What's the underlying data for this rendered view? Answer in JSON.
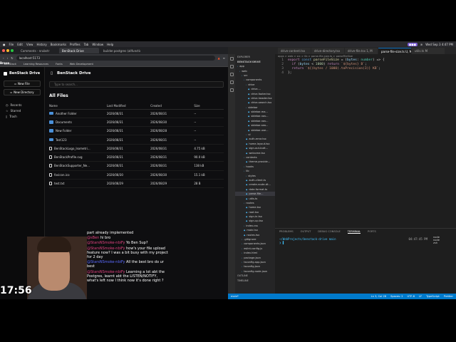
{
  "menubar": {
    "app": "Brave",
    "items": [
      "File",
      "Edit",
      "View",
      "History",
      "Bookmarks",
      "Profiles",
      "Tab",
      "Window",
      "Help"
    ],
    "datetime": "Wed Sep 3  4:47 PM"
  },
  "browser": {
    "tabs": [
      "Comments - nrubstr",
      "BenStack Drive",
      "builder.postgres (allfunctions)"
    ],
    "url": "localhost:5173",
    "bookmarks": [
      "BenStack",
      "Learning Resources",
      "Fonts",
      "Web Development"
    ]
  },
  "drive": {
    "brand": "BenStack Drive",
    "header_title": "BenStack Drive",
    "new_file": "New File",
    "new_directory": "New Directory",
    "nav": [
      "Recents",
      "Starred",
      "Trash"
    ],
    "search_placeholder": "Type to search...",
    "section_title": "All Files",
    "columns": [
      "Name",
      "Last Modified",
      "Created",
      "Size"
    ],
    "rows": [
      {
        "type": "folder",
        "name": "Another Folder",
        "modified": "2026/08/31",
        "created": "2026/08/31",
        "size": "--"
      },
      {
        "type": "folder",
        "name": "Documents",
        "modified": "2026/08/31",
        "created": "2026/08/30",
        "size": "--"
      },
      {
        "type": "folder",
        "name": "New Folder",
        "modified": "2026/08/31",
        "created": "2026/08/28",
        "size": "--"
      },
      {
        "type": "folder",
        "name": "Test123",
        "modified": "2026/08/31",
        "created": "2026/08/31",
        "size": "--"
      },
      {
        "type": "file",
        "name": "BenStackLogo_Isometri...",
        "modified": "2026/08/31",
        "created": "2026/08/31",
        "size": "4.75 kB"
      },
      {
        "type": "file",
        "name": "BenStackProfile.svg",
        "modified": "2026/08/31",
        "created": "2026/08/31",
        "size": "90.0 kB"
      },
      {
        "type": "file",
        "name": "BenStackSupporter_Ne...",
        "modified": "2026/08/31",
        "created": "2026/08/31",
        "size": "138 kB"
      },
      {
        "type": "file",
        "name": "favicon.ico",
        "modified": "2026/08/30",
        "created": "2026/08/30",
        "size": "15.1 kB"
      },
      {
        "type": "file",
        "name": "test.txt",
        "modified": "2026/08/29",
        "created": "2026/08/29",
        "size": "28 B"
      }
    ]
  },
  "stream": {
    "clock": "17:56",
    "chat": [
      {
        "user": "",
        "text": "part already implemented"
      },
      {
        "user": "@sBen",
        "text": " hi bro"
      },
      {
        "user": "@StarsNSmoke-nbiFy",
        "text": " Yo Ben Sup?"
      },
      {
        "user": "@StarsNSmoke-nbiFy",
        "text": " how's your file upload feature now? I was a bit busy with my project for 2 day"
      },
      {
        "user": "@StarsNSmoke-nbiFy",
        "text": " All the best bro do ur best"
      },
      {
        "user": "@StarsNSmoke-nbiFy",
        "text": " Learning a lot abt the Postgres, learnt abt the LISTEN/NOTIFY, what's left now I think now it's done right ?"
      }
    ]
  },
  "vscode": {
    "tabs": [
      "drive-content.tsx",
      "drive-directory.tsx",
      "drive-file.tsx 1, M",
      "parse-file-size.ts U, M",
      "utils.ts M"
    ],
    "explorer_title": "EXPLORER",
    "project": "BENSTACK-DRIVE",
    "tree": [
      {
        "name": "app",
        "depth": 0
      },
      {
        "name": "web",
        "depth": 1
      },
      {
        "name": "src",
        "depth": 2
      },
      {
        "name": "components",
        "depth": 3
      },
      {
        "name": "drive",
        "depth": 4
      },
      {
        "name": "drive-...",
        "depth": 5,
        "tsx": true
      },
      {
        "name": "drive-footer.tsx",
        "depth": 5,
        "tsx": true
      },
      {
        "name": "drive-header.tsx",
        "depth": 5,
        "tsx": true
      },
      {
        "name": "drive-search.tsx",
        "depth": 5,
        "tsx": true
      },
      {
        "name": "sidebar",
        "depth": 4
      },
      {
        "name": "sidebar-ma...",
        "depth": 5,
        "tsx": true
      },
      {
        "name": "sidebar-nav...",
        "depth": 5,
        "tsx": true
      },
      {
        "name": "sidebar-nav...",
        "depth": 5,
        "tsx": true
      },
      {
        "name": "sidebar-sea...",
        "depth": 5,
        "tsx": true
      },
      {
        "name": "sidebar-use...",
        "depth": 5,
        "tsx": true
      },
      {
        "name": "ui",
        "depth": 4
      },
      {
        "name": "auth-error.tsx",
        "depth": 4,
        "tsx": true
      },
      {
        "name": "home-layout.tsx",
        "depth": 4,
        "tsx": true
      },
      {
        "name": "sign-out-butt...",
        "depth": 4,
        "tsx": true
      },
      {
        "name": "welcome.tsx",
        "depth": 4,
        "tsx": true
      },
      {
        "name": "contexts",
        "depth": 3
      },
      {
        "name": "theme-provide...",
        "depth": 4,
        "tsx": true
      },
      {
        "name": "hooks",
        "depth": 3
      },
      {
        "name": "lib",
        "depth": 3
      },
      {
        "name": "styles",
        "depth": 4
      },
      {
        "name": "auth-client.ts",
        "depth": 4,
        "tsx": true
      },
      {
        "name": "create-route-dt...",
        "depth": 4,
        "tsx": true
      },
      {
        "name": "date-format.ts",
        "depth": 4,
        "tsx": true
      },
      {
        "name": "parse-file...",
        "depth": 4,
        "tsx": true,
        "selected": true
      },
      {
        "name": "utils.ts",
        "depth": 4,
        "tsx": true
      },
      {
        "name": "routes",
        "depth": 3
      },
      {
        "name": "home.tsx",
        "depth": 4,
        "tsx": true
      },
      {
        "name": "root.tsx",
        "depth": 4,
        "tsx": true
      },
      {
        "name": "sign-in.tsx",
        "depth": 4,
        "tsx": true
      },
      {
        "name": "sign-up.tsx",
        "depth": 4,
        "tsx": true
      },
      {
        "name": "index.css",
        "depth": 3
      },
      {
        "name": "main.tsx",
        "depth": 3,
        "tsx": true
      },
      {
        "name": "routes.tsx",
        "depth": 3,
        "tsx": true
      },
      {
        "name": ".gitignore",
        "depth": 2
      },
      {
        "name": "components.json",
        "depth": 2
      },
      {
        "name": "eslint.config.js",
        "depth": 2
      },
      {
        "name": "index.html",
        "depth": 2
      },
      {
        "name": "package.json",
        "depth": 2
      },
      {
        "name": "tsconfig.app.json",
        "depth": 2
      },
      {
        "name": "tsconfig.json",
        "depth": 2
      },
      {
        "name": "tsconfig.node.json",
        "depth": 2
      }
    ],
    "outline": "OUTLINE",
    "timeline": "TIMELINE",
    "breadcrumb": "apps > web > src > lib > parse-file-size.ts > parseFileSize",
    "code": [
      {
        "n": "1",
        "parts": [
          [
            "kw",
            "export "
          ],
          [
            "kw2",
            "const "
          ],
          [
            "fn",
            "parseFileSize"
          ],
          [
            "pl",
            " = ("
          ],
          [
            "var",
            "bytes"
          ],
          [
            "pl",
            ": "
          ],
          [
            "ty",
            "number"
          ],
          [
            "pl",
            ") => {"
          ]
        ]
      },
      {
        "n": "2",
        "parts": [
          [
            "pl",
            "  "
          ],
          [
            "kw",
            "if "
          ],
          [
            "pl",
            "("
          ],
          [
            "var",
            "bytes"
          ],
          [
            "pl",
            " < "
          ],
          [
            "num",
            "1000"
          ],
          [
            "pl",
            ") "
          ],
          [
            "kw",
            "return "
          ],
          [
            "str",
            "`${bytes} B`"
          ],
          [
            "pl",
            ";"
          ]
        ]
      },
      {
        "n": "3",
        "parts": [
          [
            "pl",
            "  "
          ],
          [
            "kw",
            "return "
          ],
          [
            "str",
            "`${(bytes / 1000).toPrecision(3)} KB`"
          ],
          [
            "pl",
            ";"
          ]
        ]
      },
      {
        "n": "4",
        "parts": [
          [
            "pl",
            "};"
          ]
        ]
      }
    ],
    "panel_tabs": [
      "PROBLEMS",
      "OUTPUT",
      "DEBUG CONSOLE",
      "TERMINAL",
      "PORTS"
    ],
    "terminal_path": "~/WebProjects/benstack-drive main",
    "terminal_time": "04:47:45 PM",
    "terminal_sessions": [
      "node",
      "node",
      "zsh"
    ],
    "status_left": "main*",
    "status_right": [
      "Ln 3, Col 28",
      "Spaces: 2",
      "UTF-8",
      "LF",
      "TypeScript",
      "Prettier"
    ]
  },
  "colors": {
    "accent": "#007acc",
    "folder": "#4a90d9",
    "chat_user": "#e0427e"
  }
}
